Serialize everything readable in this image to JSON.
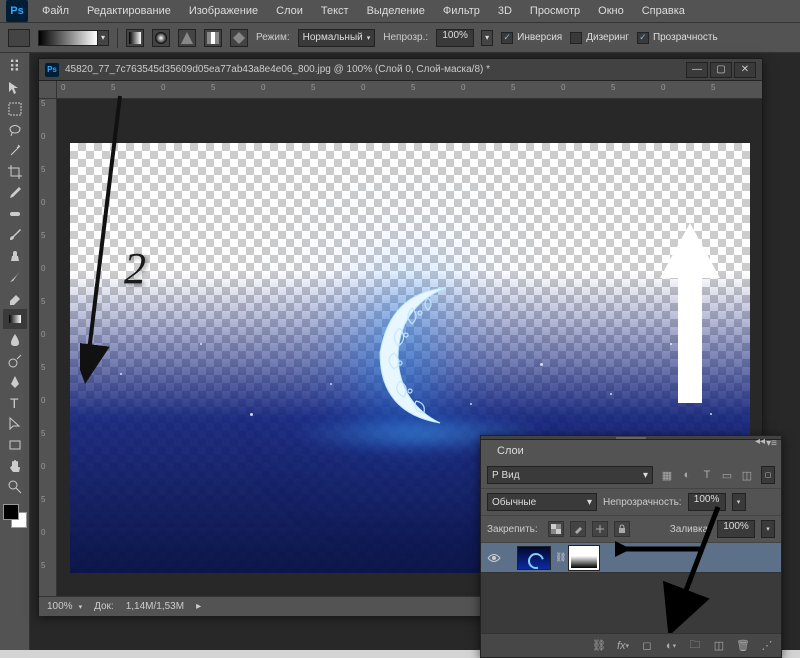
{
  "app_name": "Ps",
  "menu": [
    "Файл",
    "Редактирование",
    "Изображение",
    "Слои",
    "Текст",
    "Выделение",
    "Фильтр",
    "3D",
    "Просмотр",
    "Окно",
    "Справка"
  ],
  "options": {
    "mode_label": "Режим:",
    "mode_value": "Нормальный",
    "opacity_label": "Непрозр.:",
    "opacity_value": "100%",
    "reverse_label": "Инверсия",
    "dither_label": "Дизеринг",
    "transparency_label": "Прозрачность"
  },
  "document": {
    "title": "45820_77_7c763545d35609d05ea77ab43a8e4e06_800.jpg @ 100% (Слой 0, Слой-маска/8) *",
    "zoom": "100%",
    "docsize_label": "Док:",
    "docsize_value": "1,14M/1,53M"
  },
  "layers_panel": {
    "title": "Слои",
    "filter_kind": "Р Вид",
    "blend_mode": "Обычные",
    "opacity_label": "Непрозрачность:",
    "opacity_value": "100%",
    "lock_label": "Закрепить:",
    "fill_label": "Заливка:",
    "fill_value": "100%"
  },
  "tutorial": {
    "step_number": "2"
  },
  "ruler_ticks_h": [
    "0",
    "5",
    "0",
    "5",
    "0",
    "5",
    "0",
    "5",
    "0",
    "5",
    "0",
    "5",
    "0",
    "5"
  ],
  "ruler_ticks_v": [
    "5",
    "0",
    "5",
    "0",
    "5",
    "0",
    "5",
    "0",
    "5",
    "0",
    "5",
    "0",
    "5",
    "0",
    "5"
  ],
  "colors": {
    "ui_bg": "#535353",
    "canvas_bg": "#282828",
    "accent": "#31a8ff"
  }
}
